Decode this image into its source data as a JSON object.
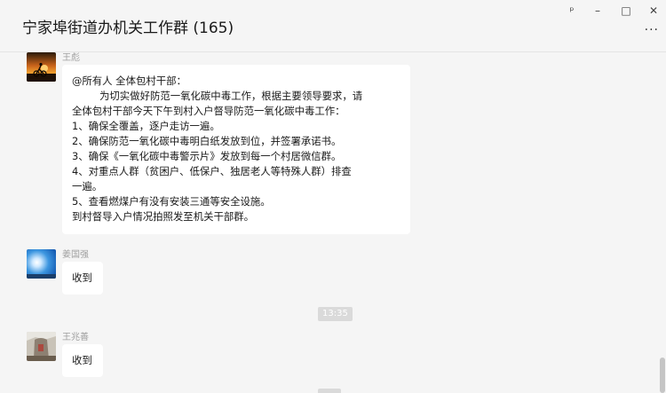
{
  "window": {
    "title": "宁家埠街道办机关工作群 (165)",
    "controls": {
      "pin": "ᵖ",
      "minimize": "–",
      "maximize": "□",
      "close": "✕",
      "more": "..."
    }
  },
  "messages": [
    {
      "sender": "王彪",
      "avatar": "sunset-cyclist-avatar",
      "lines": [
        "@所有人 全体包村干部：",
        "为切实做好防范一氧化碳中毒工作，根据主要领导要求，请",
        "全体包村干部今天下午到村入户督导防范一氧化碳中毒工作：",
        "1、确保全覆盖，逐户走访一遍。",
        "2、确保防范一氧化碳中毒明白纸发放到位，并签署承诺书。",
        "3、确保《一氧化碳中毒警示片》发放到每一个村居微信群。",
        "4、对重点人群（贫困户、低保户、独居老人等特殊人群）排查",
        "一遍。",
        "5、查看燃煤户有没有安装三通等安全设施。",
        "到村督导入户情况拍照发至机关干部群。"
      ]
    },
    {
      "sender": "姜国强",
      "avatar": "blue-sky-sun-avatar",
      "text": "收到"
    },
    {
      "sender": "王兆善",
      "avatar": "stone-monument-avatar",
      "text": "收到"
    }
  ],
  "timestamps": [
    "13:35",
    ""
  ],
  "colors": {
    "background": "#f5f5f5",
    "bubble": "#ffffff",
    "sender": "#a0a0a0",
    "timestamp_pill": "#dadada"
  }
}
